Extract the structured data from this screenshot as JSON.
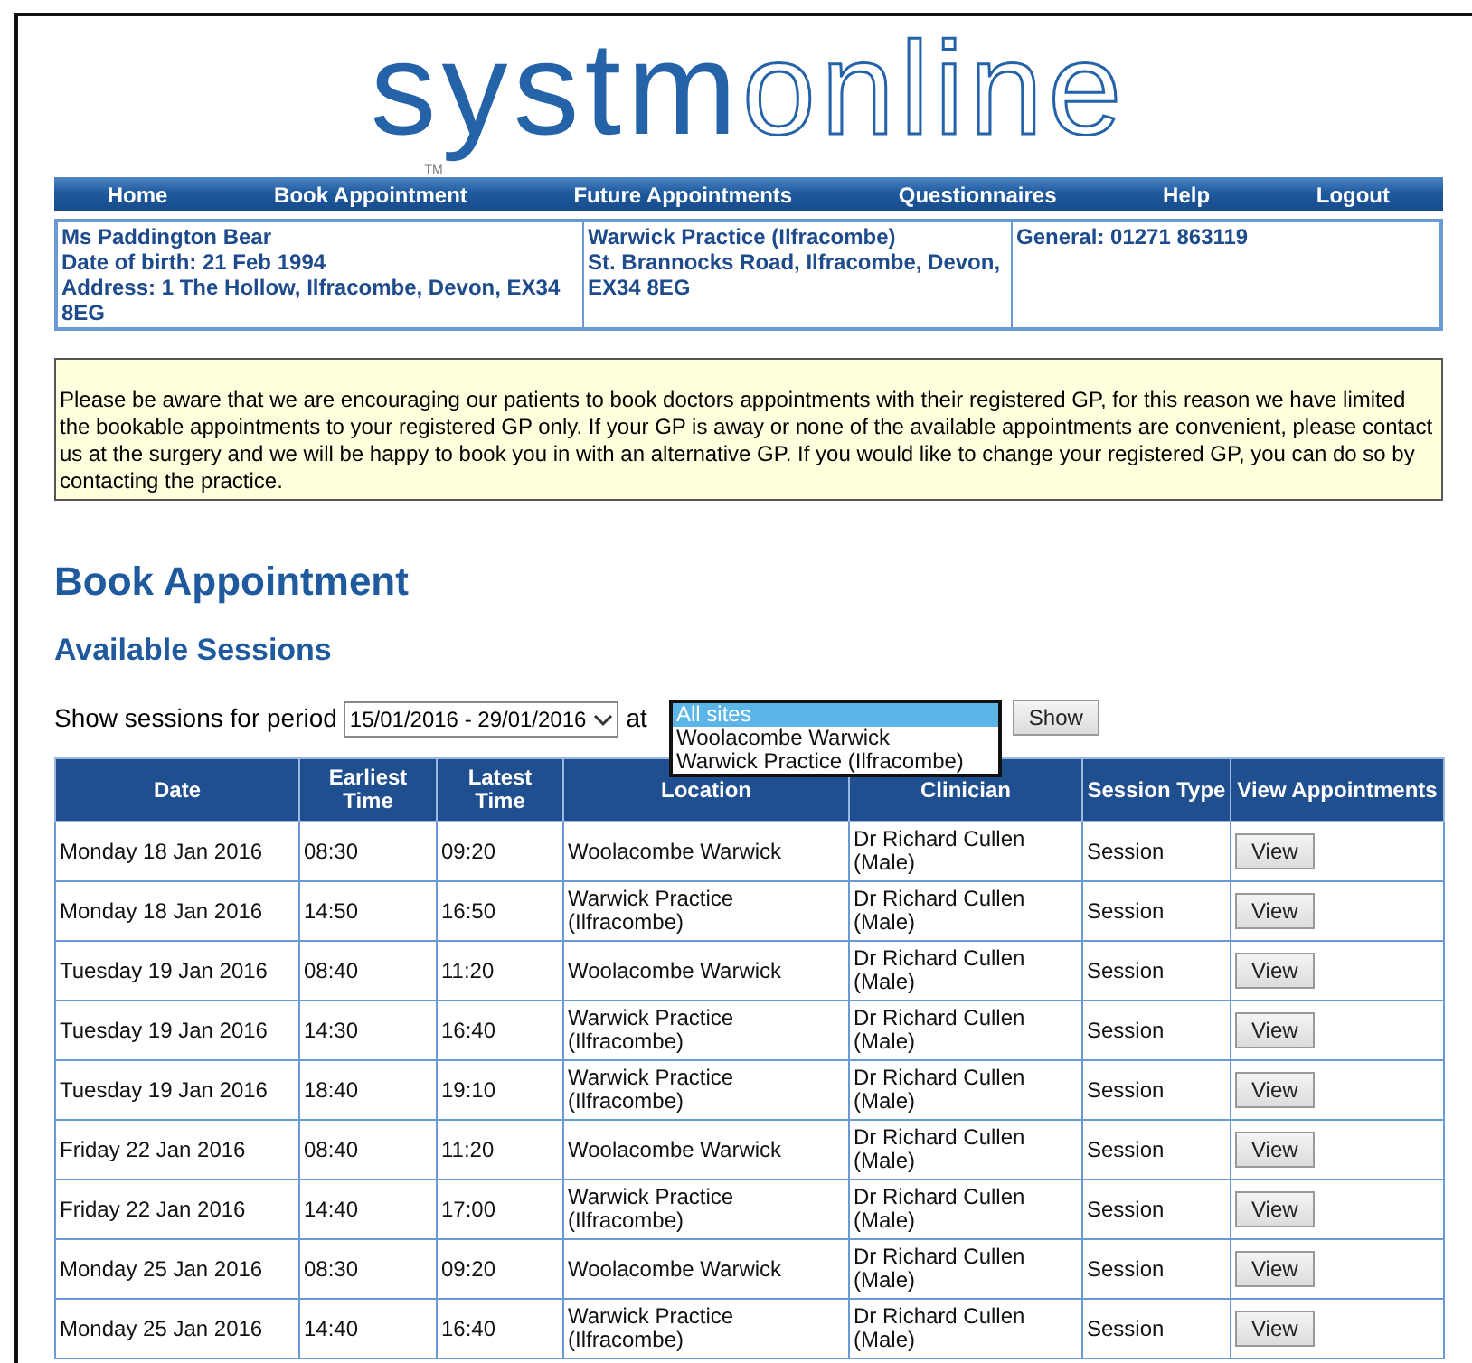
{
  "logo": {
    "filled": "systm",
    "outlined": "online",
    "mark": "TM"
  },
  "nav": [
    "Home",
    "Book Appointment",
    "Future Appointments",
    "Questionnaires",
    "Help",
    "Logout"
  ],
  "patient": {
    "lines": [
      "Ms Paddington Bear",
      "Date of birth: 21 Feb 1994",
      "Address: 1 The Hollow, Ilfracombe, Devon, EX34 8EG"
    ]
  },
  "practice": {
    "lines": [
      "Warwick Practice (Ilfracombe)",
      "St. Brannocks Road, Ilfracombe, Devon, EX34 8EG"
    ]
  },
  "phone": "General: 01271 863119",
  "notice": "Please be aware that we are encouraging our patients to book doctors appointments with their registered GP, for this reason we have limited the bookable appointments to your registered GP only. If your GP is away or none of the available appointments are convenient, please contact us at the surgery and we will be happy to book you in with an alternative GP. If you would like to change your registered GP, you can do so by contacting the practice.",
  "heading": "Book Appointment",
  "subheading": "Available Sessions",
  "filter": {
    "label": "Show sessions for period",
    "period": "15/01/2016 - 29/01/2016",
    "at_label": "at",
    "button": "Show",
    "site_options": [
      {
        "label": "All sites",
        "selected": true
      },
      {
        "label": "Woolacombe Warwick",
        "selected": false
      },
      {
        "label": "Warwick Practice (Ilfracombe)",
        "selected": false
      }
    ]
  },
  "table": {
    "columns": [
      "Date",
      "Earliest Time",
      "Latest Time",
      "Location",
      "Clinician",
      "Session Type",
      "View Appointments"
    ],
    "rows": [
      {
        "date": "Monday 18 Jan 2016",
        "earliest": "08:30",
        "latest": "09:20",
        "location": "Woolacombe Warwick",
        "clinician": "Dr Richard Cullen (Male)",
        "type": "Session",
        "action": "View"
      },
      {
        "date": "Monday 18 Jan 2016",
        "earliest": "14:50",
        "latest": "16:50",
        "location": "Warwick Practice (Ilfracombe)",
        "clinician": "Dr Richard Cullen (Male)",
        "type": "Session",
        "action": "View"
      },
      {
        "date": "Tuesday 19 Jan 2016",
        "earliest": "08:40",
        "latest": "11:20",
        "location": "Woolacombe Warwick",
        "clinician": "Dr Richard Cullen (Male)",
        "type": "Session",
        "action": "View"
      },
      {
        "date": "Tuesday 19 Jan 2016",
        "earliest": "14:30",
        "latest": "16:40",
        "location": "Warwick Practice (Ilfracombe)",
        "clinician": "Dr Richard Cullen (Male)",
        "type": "Session",
        "action": "View"
      },
      {
        "date": "Tuesday 19 Jan 2016",
        "earliest": "18:40",
        "latest": "19:10",
        "location": "Warwick Practice (Ilfracombe)",
        "clinician": "Dr Richard Cullen (Male)",
        "type": "Session",
        "action": "View"
      },
      {
        "date": "Friday 22 Jan 2016",
        "earliest": "08:40",
        "latest": "11:20",
        "location": "Woolacombe Warwick",
        "clinician": "Dr Richard Cullen (Male)",
        "type": "Session",
        "action": "View"
      },
      {
        "date": "Friday 22 Jan 2016",
        "earliest": "14:40",
        "latest": "17:00",
        "location": "Warwick Practice (Ilfracombe)",
        "clinician": "Dr Richard Cullen (Male)",
        "type": "Session",
        "action": "View"
      },
      {
        "date": "Monday 25 Jan 2016",
        "earliest": "08:30",
        "latest": "09:20",
        "location": "Woolacombe Warwick",
        "clinician": "Dr Richard Cullen (Male)",
        "type": "Session",
        "action": "View"
      },
      {
        "date": "Monday 25 Jan 2016",
        "earliest": "14:40",
        "latest": "16:40",
        "location": "Warwick Practice (Ilfracombe)",
        "clinician": "Dr Richard Cullen (Male)",
        "type": "Session",
        "action": "View"
      }
    ]
  }
}
